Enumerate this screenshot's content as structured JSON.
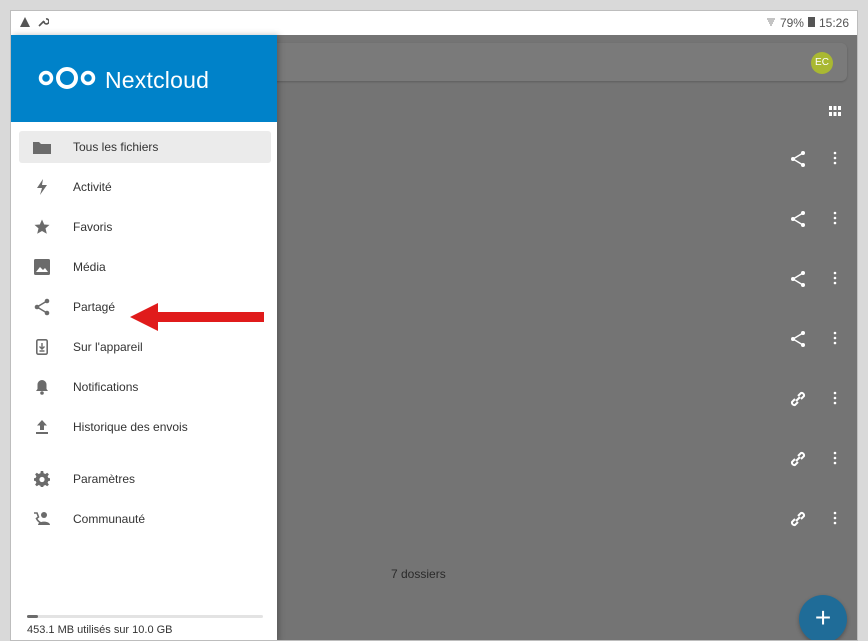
{
  "status": {
    "left_icons": [
      "warning-icon",
      "wrench-icon"
    ],
    "battery_percent": "79%",
    "time": "15:26"
  },
  "header": {
    "brand": "Nextcloud",
    "avatar_initials": "EC"
  },
  "drawer": {
    "items": [
      {
        "label": "Tous les fichiers",
        "icon": "folder-icon",
        "active": true
      },
      {
        "label": "Activité",
        "icon": "lightning-icon"
      },
      {
        "label": "Favoris",
        "icon": "star-icon"
      },
      {
        "label": "Média",
        "icon": "image-icon"
      },
      {
        "label": "Partagé",
        "icon": "share-icon"
      },
      {
        "label": "Sur l'appareil",
        "icon": "device-download-icon"
      },
      {
        "label": "Notifications",
        "icon": "bell-icon"
      },
      {
        "label": "Historique des envois",
        "icon": "upload-icon"
      },
      {
        "label": "Paramètres",
        "icon": "gear-icon"
      },
      {
        "label": "Communauté",
        "icon": "community-icon"
      }
    ],
    "quota": {
      "text": "453.1 MB utilisés sur 10.0 GB",
      "used_fraction": 0.045
    }
  },
  "files": {
    "count_label": "7 dossiers",
    "row_actions": [
      "share",
      "share",
      "share",
      "share",
      "link",
      "link",
      "link"
    ]
  },
  "fab": {
    "label": "+"
  },
  "colors": {
    "brand_blue": "#0082c9",
    "avatar": "#a9b832",
    "fab": "#1f6c98",
    "arrow": "#e01b1b"
  }
}
